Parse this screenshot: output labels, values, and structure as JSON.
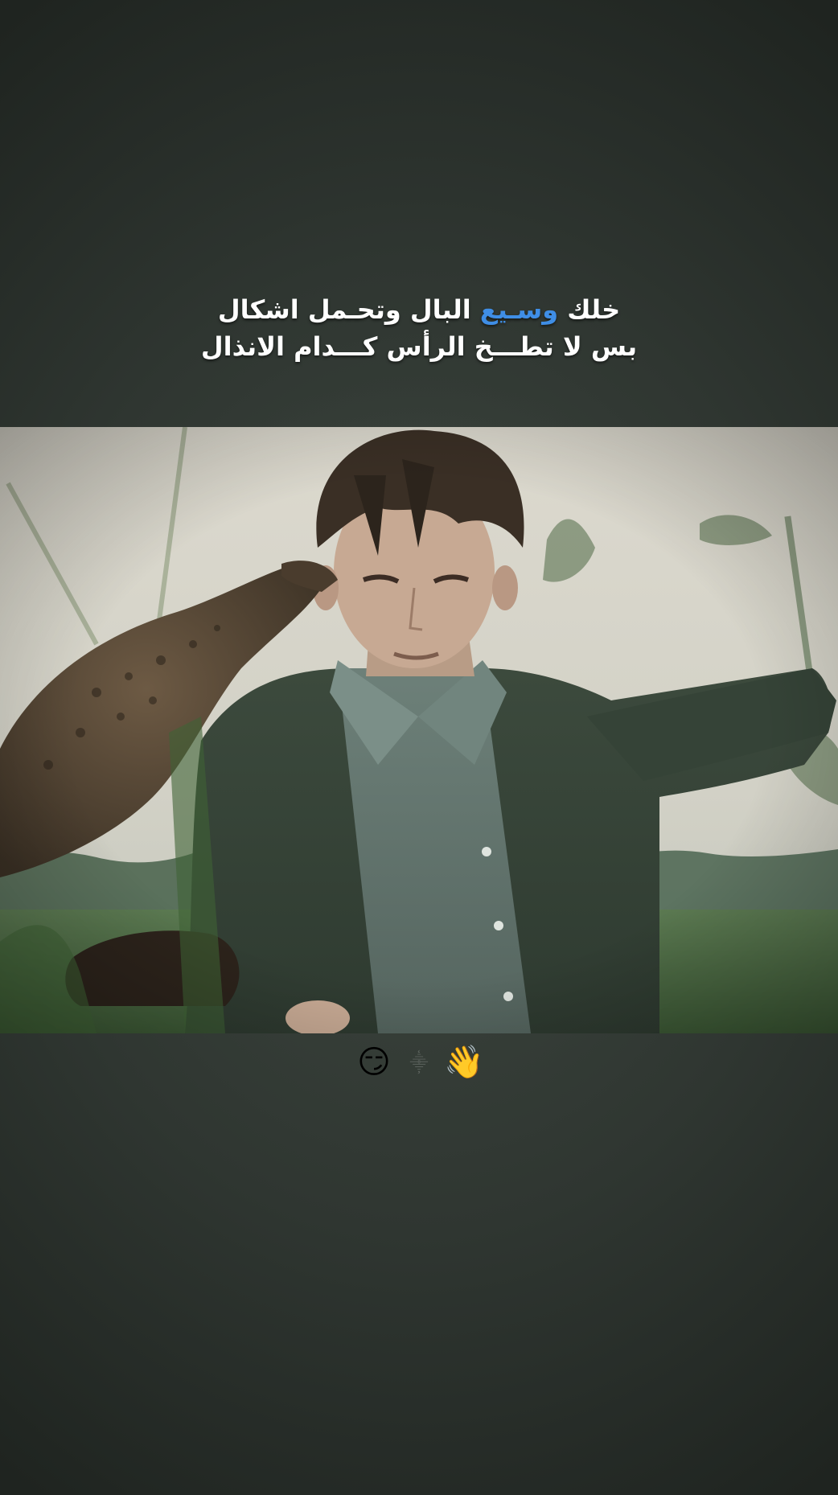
{
  "caption": {
    "line1_start": "خلك ",
    "line1_highlight": "وسـيع",
    "line1_end": " البال وتحـمل اشكال",
    "line2": "بس لا تطـــخ الرأس كـــدام الانذال",
    "highlight_color": "#3f8ee6"
  },
  "photo": {
    "icon": "film-still-boy-with-kestrel"
  },
  "emoji_row": {
    "left_emoji": "😏",
    "separator": "⸎",
    "right_emoji": "👋"
  }
}
